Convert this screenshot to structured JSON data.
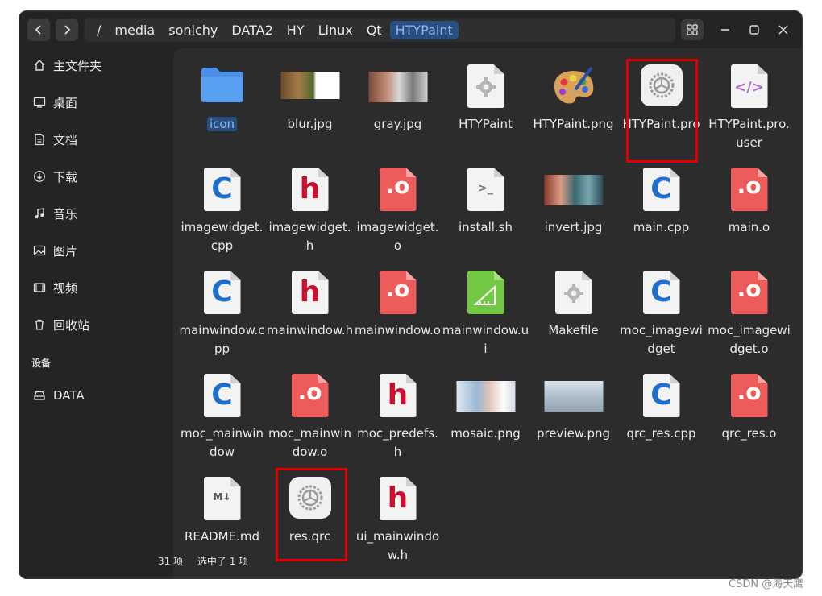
{
  "breadcrumbs": [
    "/",
    "media",
    "sonichy",
    "DATA2",
    "HY",
    "Linux",
    "Qt",
    "HTYPaint"
  ],
  "sidebar": {
    "places": [
      {
        "label": "主文件夹",
        "icon": "home-icon"
      },
      {
        "label": "桌面",
        "icon": "desktop-icon"
      },
      {
        "label": "文档",
        "icon": "document-icon"
      },
      {
        "label": "下载",
        "icon": "download-icon"
      },
      {
        "label": "音乐",
        "icon": "music-icon"
      },
      {
        "label": "图片",
        "icon": "picture-icon"
      },
      {
        "label": "视频",
        "icon": "video-icon"
      },
      {
        "label": "回收站",
        "icon": "trash-icon"
      }
    ],
    "devices_header": "设备",
    "devices": [
      {
        "label": "DATA",
        "icon": "drive-icon"
      }
    ]
  },
  "files": [
    {
      "name": "icon",
      "type": "folder"
    },
    {
      "name": "blur.jpg",
      "type": "image"
    },
    {
      "name": "gray.jpg",
      "type": "image"
    },
    {
      "name": "HTYPaint",
      "type": "executable"
    },
    {
      "name": "HTYPaint.png",
      "type": "palette"
    },
    {
      "name": "HTYPaint.pro",
      "type": "qt-project"
    },
    {
      "name": "HTYPaint.pro.user",
      "type": "xml"
    },
    {
      "name": "imagewidget.cpp",
      "type": "cpp"
    },
    {
      "name": "imagewidget.h",
      "type": "header"
    },
    {
      "name": "imagewidget.o",
      "type": "object"
    },
    {
      "name": "install.sh",
      "type": "shell"
    },
    {
      "name": "invert.jpg",
      "type": "image"
    },
    {
      "name": "main.cpp",
      "type": "cpp"
    },
    {
      "name": "main.o",
      "type": "object"
    },
    {
      "name": "mainwindow.cpp",
      "type": "cpp"
    },
    {
      "name": "mainwindow.h",
      "type": "header"
    },
    {
      "name": "mainwindow.o",
      "type": "object"
    },
    {
      "name": "mainwindow.ui",
      "type": "ui"
    },
    {
      "name": "Makefile",
      "type": "makefile"
    },
    {
      "name": "moc_imagewidget",
      "type": "cpp"
    },
    {
      "name": "moc_imagewidget.o",
      "type": "object"
    },
    {
      "name": "moc_mainwindow",
      "type": "cpp"
    },
    {
      "name": "moc_mainwindow.o",
      "type": "object"
    },
    {
      "name": "moc_predefs.h",
      "type": "header"
    },
    {
      "name": "mosaic.png",
      "type": "image"
    },
    {
      "name": "preview.png",
      "type": "image"
    },
    {
      "name": "qrc_res.cpp",
      "type": "cpp"
    },
    {
      "name": "qrc_res.o",
      "type": "object"
    },
    {
      "name": "README.md",
      "type": "markdown"
    },
    {
      "name": "res.qrc",
      "type": "qt-project"
    },
    {
      "name": "ui_mainwindow.h",
      "type": "header"
    }
  ],
  "status": {
    "count": "31 项",
    "selected": "选中了 1 项"
  },
  "watermark": "CSDN @海天鹰",
  "colors": {
    "accent": "#294f80",
    "highlight": "#e00000",
    "cpp": "#1e6ed0",
    "header": "#c8102e"
  }
}
